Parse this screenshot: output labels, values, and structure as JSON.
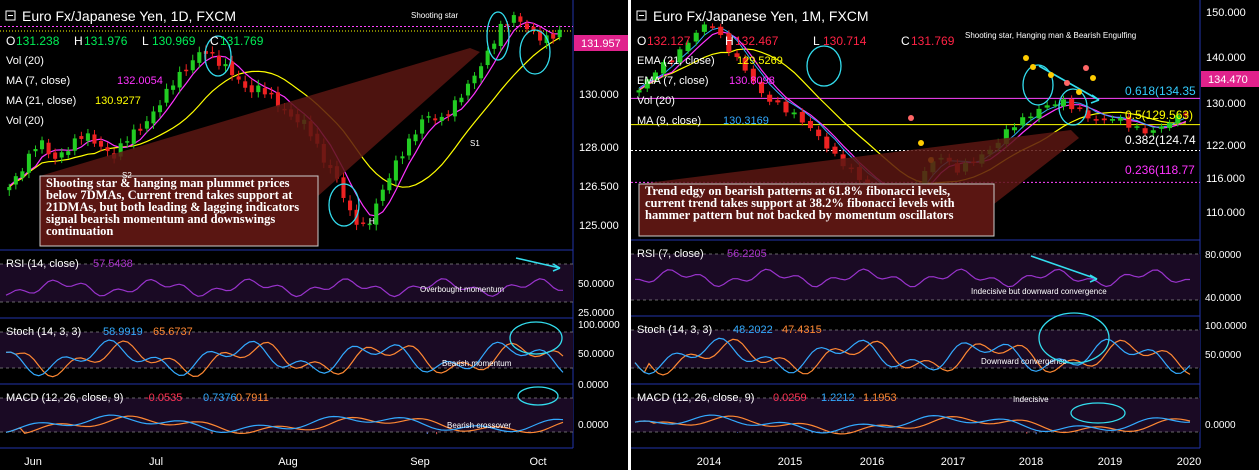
{
  "charts": [
    {
      "id": "left",
      "title": "Euro Fx/Japanese Yen, 1D, FXCM",
      "ohlc": {
        "o": "131.238",
        "h": "131.976",
        "l": "130.969",
        "c": "131.769"
      },
      "indicators": [
        {
          "label": "Vol (20)",
          "value": "",
          "color": "#ffffff"
        },
        {
          "label": "MA (7, close)",
          "value": "132.0054",
          "color": "#ff33ff"
        },
        {
          "label": "MA (21, close)",
          "value": "130.9277",
          "color": "#ffff00"
        },
        {
          "label": "Vol (20)",
          "value": "",
          "color": "#ffffff"
        }
      ],
      "price_tag": "131.957",
      "price_ticks": [
        "130.000",
        "128.000",
        "126.500",
        "125.000"
      ],
      "annotations": {
        "top": "Shooting star",
        "h": "H",
        "s1": "S1",
        "s2": "S2"
      },
      "callout": "Shooting star & hanging man plummet prices below 7DMAs, Current trend takes support at 21DMAs, but both leading & lagging indicators signal bearish momentum and downswings continuation",
      "rsi": {
        "label": "RSI (14, close)",
        "value": "57.5438",
        "ticks": [
          "50.0000",
          "25.0000"
        ],
        "note": "Overbought momentum"
      },
      "stoch": {
        "label": "Stoch (14, 3, 3)",
        "k": "58.9919",
        "d": "65.6737",
        "ticks": [
          "100.0000",
          "50.0000",
          "0.0000"
        ],
        "note": "Bearish momentum"
      },
      "macd": {
        "label": "MACD (12, 26, close, 9)",
        "hist": "-0.0535",
        "macd": "0.7376",
        "signal": "0.7911",
        "ticks": [
          "0.0000"
        ],
        "note": "Bearish crossover"
      },
      "x_ticks": [
        "Jun",
        "Jul",
        "Aug",
        "Sep",
        "Oct"
      ]
    },
    {
      "id": "right",
      "title": "Euro Fx/Japanese Yen, 1M, FXCM",
      "ohlc": {
        "o": "132.127",
        "h": "132.467",
        "l": "130.714",
        "c": "131.769"
      },
      "indicators": [
        {
          "label": "EMA (21, close)",
          "value": "129.5269",
          "color": "#ffff00"
        },
        {
          "label": "EMA (7, close)",
          "value": "130.8098",
          "color": "#ff33ff"
        },
        {
          "label": "Vol (20)",
          "value": "",
          "color": "#ffffff"
        },
        {
          "label": "MA (9, close)",
          "value": "130.3169",
          "color": "#33aaff"
        }
      ],
      "price_tag": "134.470",
      "price_ticks": [
        "150.000",
        "140.000",
        "130.000",
        "122.000",
        "116.000",
        "110.000"
      ],
      "fib": [
        {
          "label": "0.618(134.35",
          "color": "#33ccff"
        },
        {
          "label": "0.5(129.563)",
          "color": "#ffff00"
        },
        {
          "label": "0.382(124.74",
          "color": "#ffffff"
        },
        {
          "label": "0.236(118.77",
          "color": "#ff33ff"
        }
      ],
      "annotations": {
        "top": "Shooting star, Hanging man & Bearish Engulfing"
      },
      "callout": "Trend edgy on bearish patterns at 61.8% fibonacci levels, current trend takes support at 38.2% fibonacci levels with hammer pattern but not backed by momentum oscillators",
      "rsi": {
        "label": "RSI (7, close)",
        "value": "56.2205",
        "ticks": [
          "80.0000",
          "40.0000"
        ],
        "note": "Indecisive but downward convergence"
      },
      "stoch": {
        "label": "Stoch (14, 3, 3)",
        "k": "48.2022",
        "d": "47.4315",
        "ticks": [
          "100.0000",
          "50.0000"
        ],
        "note": "Downward convergence"
      },
      "macd": {
        "label": "MACD (12, 26, close, 9)",
        "hist": "0.0259",
        "macd": "1.2212",
        "signal": "1.1953",
        "ticks": [
          "0.0000"
        ],
        "note": "Indecisive"
      },
      "x_ticks": [
        "2014",
        "2015",
        "2016",
        "2017",
        "2018",
        "2019",
        "2020"
      ]
    }
  ],
  "chart_data": [
    {
      "type": "candlestick",
      "title": "Euro Fx/Japanese Yen, 1D, FXCM",
      "x_range": [
        "Jun",
        "Oct"
      ],
      "ylim": [
        124.5,
        132.5
      ],
      "close_path": [
        126.6,
        127.3,
        128.2,
        127.5,
        127.9,
        128.4,
        128.0,
        127.6,
        128.3,
        128.6,
        129.3,
        130.1,
        130.6,
        131.2,
        130.8,
        130.4,
        129.8,
        129.9,
        129.4,
        128.9,
        128.7,
        127.6,
        126.9,
        125.6,
        125.2,
        126.4,
        127.4,
        128.2,
        129.0,
        128.8,
        129.4,
        130.1,
        130.9,
        131.9,
        132.3,
        131.8,
        131.5,
        131.77
      ],
      "series": [
        {
          "name": "MA (7, close)",
          "last": 132.0054
        },
        {
          "name": "MA (21, close)",
          "last": 130.9277
        }
      ],
      "last_close": 131.769
    },
    {
      "type": "candlestick",
      "title": "Euro Fx/Japanese Yen, 1M, FXCM",
      "x_range": [
        "2014",
        "2020"
      ],
      "ylim": [
        108,
        151
      ],
      "close_path": [
        136,
        140,
        142,
        146,
        149,
        144,
        140,
        135,
        133,
        131,
        128,
        124,
        121,
        118,
        116,
        115,
        120,
        124,
        121,
        123,
        125,
        129,
        131,
        133,
        134,
        132,
        130,
        131,
        129,
        128,
        130,
        131.77
      ],
      "series": [
        {
          "name": "EMA (21, close)",
          "last": 129.5269
        },
        {
          "name": "EMA (7, close)",
          "last": 130.8098
        },
        {
          "name": "MA (9, close)",
          "last": 130.3169
        }
      ],
      "fibonacci": [
        {
          "level": 0.618,
          "price": 134.35
        },
        {
          "level": 0.5,
          "price": 129.563
        },
        {
          "level": 0.382,
          "price": 124.74
        },
        {
          "level": 0.236,
          "price": 118.77
        }
      ],
      "last_close": 131.769
    }
  ],
  "colors": {
    "up": "#22cc22",
    "down": "#ee2222",
    "ma_fast": "#ff33ff",
    "ma_slow": "#ffff00",
    "osc_a": "#33aaff",
    "osc_b": "#ff8833",
    "cyan": "#33ddee",
    "panel_bg": "#1a0a24"
  }
}
